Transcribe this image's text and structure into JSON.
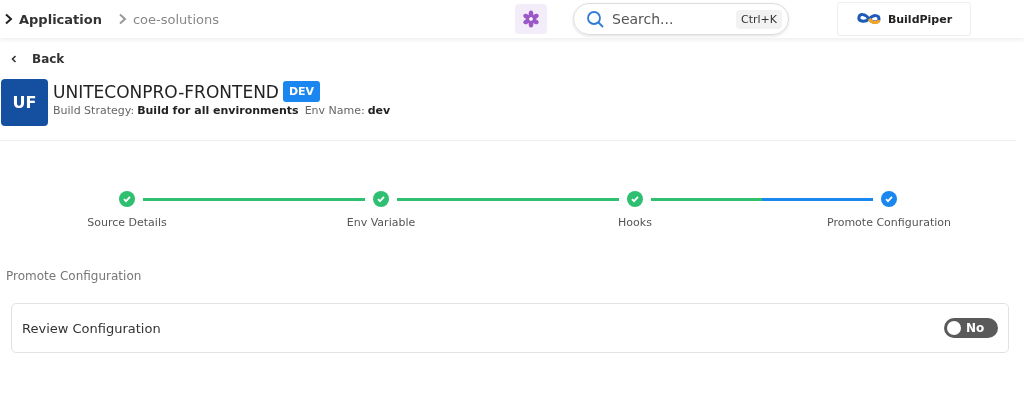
{
  "breadcrumb": [
    {
      "label": "Application",
      "current": true
    },
    {
      "label": "coe-solutions",
      "current": false
    }
  ],
  "search": {
    "placeholder": "Search...",
    "shortcut": "Ctrl+K"
  },
  "brand": {
    "name": "BuildPiper"
  },
  "back": {
    "label": "Back"
  },
  "service": {
    "initials": "UF",
    "name": "UNITECONPRO-FRONTEND",
    "env_badge": "DEV",
    "build_strategy_label": "Build Strategy:",
    "build_strategy": "Build for all environments",
    "env_name_label": "Env Name:",
    "env_name": "dev"
  },
  "steps": [
    {
      "label": "Source Details",
      "completed": true,
      "active": false
    },
    {
      "label": "Env Variable",
      "completed": true,
      "active": false
    },
    {
      "label": "Hooks",
      "completed": true,
      "active": false
    },
    {
      "label": "Promote Configuration",
      "completed": true,
      "active": true
    }
  ],
  "section_title": "Promote Configuration",
  "settings": [
    {
      "label": "Review Configuration",
      "on": false,
      "state_text": "No"
    }
  ]
}
